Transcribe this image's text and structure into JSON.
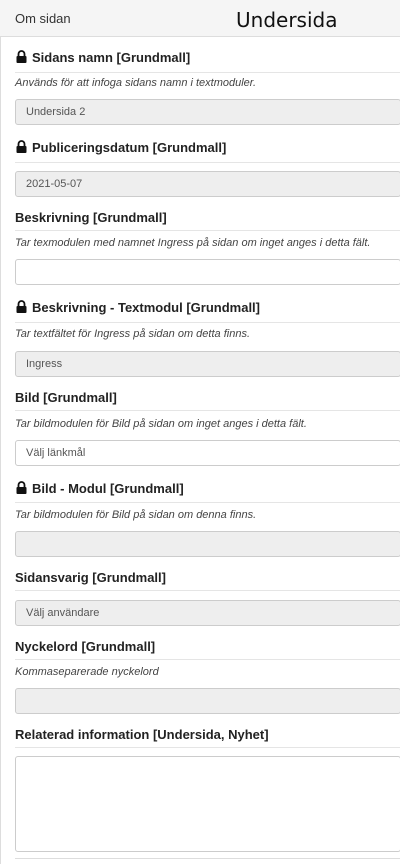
{
  "header": {
    "panel_title": "Om sidan",
    "overlay_title": "Undersida"
  },
  "icons": {
    "lock": "lock-icon"
  },
  "fields": {
    "name": {
      "label": "Sidans namn [Grundmall]",
      "help": "Används för att infoga sidans namn i textmoduler.",
      "value": "Undersida 2",
      "locked": true
    },
    "published": {
      "label": "Publiceringsdatum [Grundmall]",
      "value": "2021-05-07",
      "locked": true
    },
    "description": {
      "label": "Beskrivning [Grundmall]",
      "help": "Tar texmodulen med namnet Ingress på sidan om inget anges i detta fält.",
      "value": ""
    },
    "description_module": {
      "label": "Beskrivning - Textmodul [Grundmall]",
      "help": "Tar textfältet för Ingress på sidan om detta finns.",
      "value": "Ingress",
      "locked": true
    },
    "image": {
      "label": "Bild [Grundmall]",
      "help": "Tar bildmodulen för Bild på sidan om inget anges i detta fält.",
      "value": "Välj länkmål"
    },
    "image_module": {
      "label": "Bild - Modul [Grundmall]",
      "help": "Tar bildmodulen för Bild på sidan om denna finns.",
      "value": "",
      "locked": true
    },
    "owner": {
      "label": "Sidansvarig [Grundmall]",
      "value": "Välj användare"
    },
    "keywords": {
      "label": "Nyckelord [Grundmall]",
      "help": "Kommaseparerade nyckelord",
      "value": ""
    },
    "related": {
      "label": "Relaterad information [Undersida, Nyhet]",
      "value": ""
    }
  }
}
